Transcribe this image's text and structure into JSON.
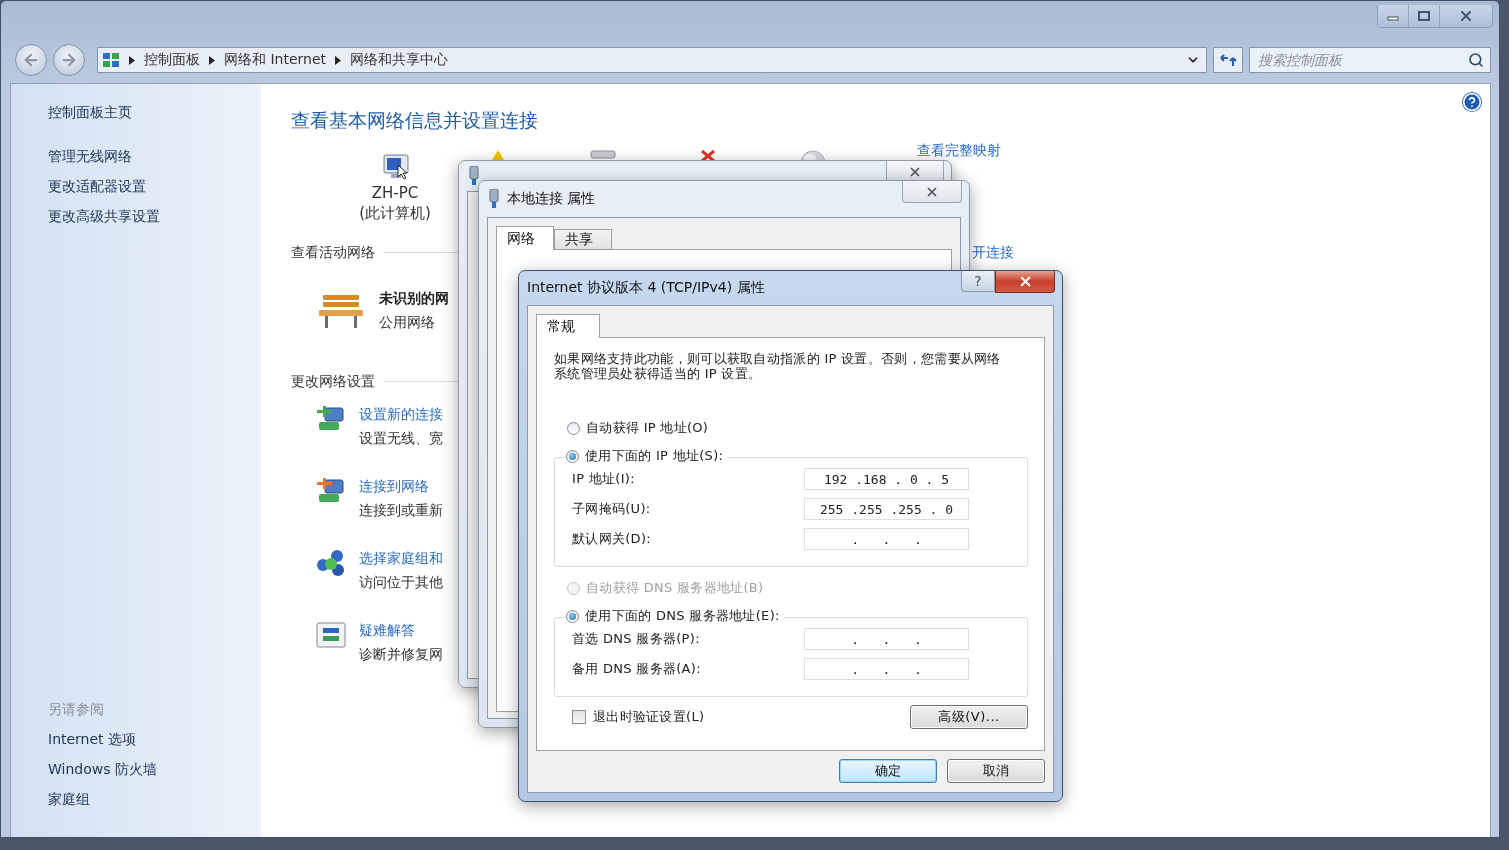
{
  "address_bar": {
    "breadcrumbs": [
      "控制面板",
      "网络和 Internet",
      "网络和共享中心"
    ]
  },
  "search": {
    "placeholder": "搜索控制面板"
  },
  "sidebar": {
    "items": [
      "控制面板主页",
      "管理无线网络",
      "更改适配器设置",
      "更改高级共享设置"
    ],
    "see_also": {
      "heading": "另请参阅",
      "items": [
        "Internet 选项",
        "Windows 防火墙",
        "家庭组"
      ]
    }
  },
  "content": {
    "title": "查看基本网络信息并设置连接",
    "map": {
      "computer_name": "ZH-PC",
      "computer_note": "(此计算机)",
      "full_map_link": "查看完整映射"
    },
    "active_networks": {
      "heading": "查看活动网络",
      "network_name": "未识别的网",
      "network_type": "公用网络",
      "link_fragment": "开连接"
    },
    "settings": {
      "heading": "更改网络设置",
      "tasks": [
        {
          "kind": "new-connection",
          "title": "设置新的连接",
          "description": "设置无线、宽"
        },
        {
          "kind": "connect",
          "title": "连接到网络",
          "description": "连接到或重新"
        },
        {
          "kind": "homegroup",
          "title": "选择家庭组和",
          "description": "访问位于其他"
        },
        {
          "kind": "troubleshoot",
          "title": "疑难解答",
          "description": "诊断并修复网"
        }
      ]
    }
  },
  "properties_dialog": {
    "title": "本地连接 属性",
    "tabs": [
      {
        "label": "网络",
        "selected": true
      },
      {
        "label": "共享",
        "selected": false
      }
    ]
  },
  "tcpip_dialog": {
    "title": "Internet 协议版本 4 (TCP/IPv4) 属性",
    "help_button": "?",
    "tabs": [
      {
        "label": "常规",
        "selected": true
      }
    ],
    "description": "如果网络支持此功能，则可以获取自动指派的 IP 设置。否则，您需要从网络系统管理员处获得适当的 IP 设置。",
    "ip_options": [
      {
        "label": "自动获得 IP 地址(O)",
        "selected": false,
        "disabled": false
      },
      {
        "label": "使用下面的 IP 地址(S):",
        "selected": true,
        "disabled": false
      }
    ],
    "ip_fields": [
      {
        "label": "IP 地址(I):",
        "value": "192 .168 . 0 . 5"
      },
      {
        "label": "子网掩码(U):",
        "value": "255 .255 .255 . 0"
      },
      {
        "label": "默认网关(D):",
        "value": ".   .   ."
      }
    ],
    "dns_options": [
      {
        "label": "自动获得 DNS 服务器地址(B)",
        "selected": false,
        "disabled": true
      },
      {
        "label": "使用下面的 DNS 服务器地址(E):",
        "selected": true,
        "disabled": false
      }
    ],
    "dns_fields": [
      {
        "label": "首选 DNS 服务器(P):",
        "value": ".   .   ."
      },
      {
        "label": "备用 DNS 服务器(A):",
        "value": ".   .   ."
      }
    ],
    "validate_on_exit": {
      "label": "退出时验证设置(L)",
      "checked": false
    },
    "advanced_button": "高级(V)...",
    "buttons": [
      {
        "label": "确定",
        "default": true
      },
      {
        "label": "取消",
        "default": false
      }
    ]
  }
}
